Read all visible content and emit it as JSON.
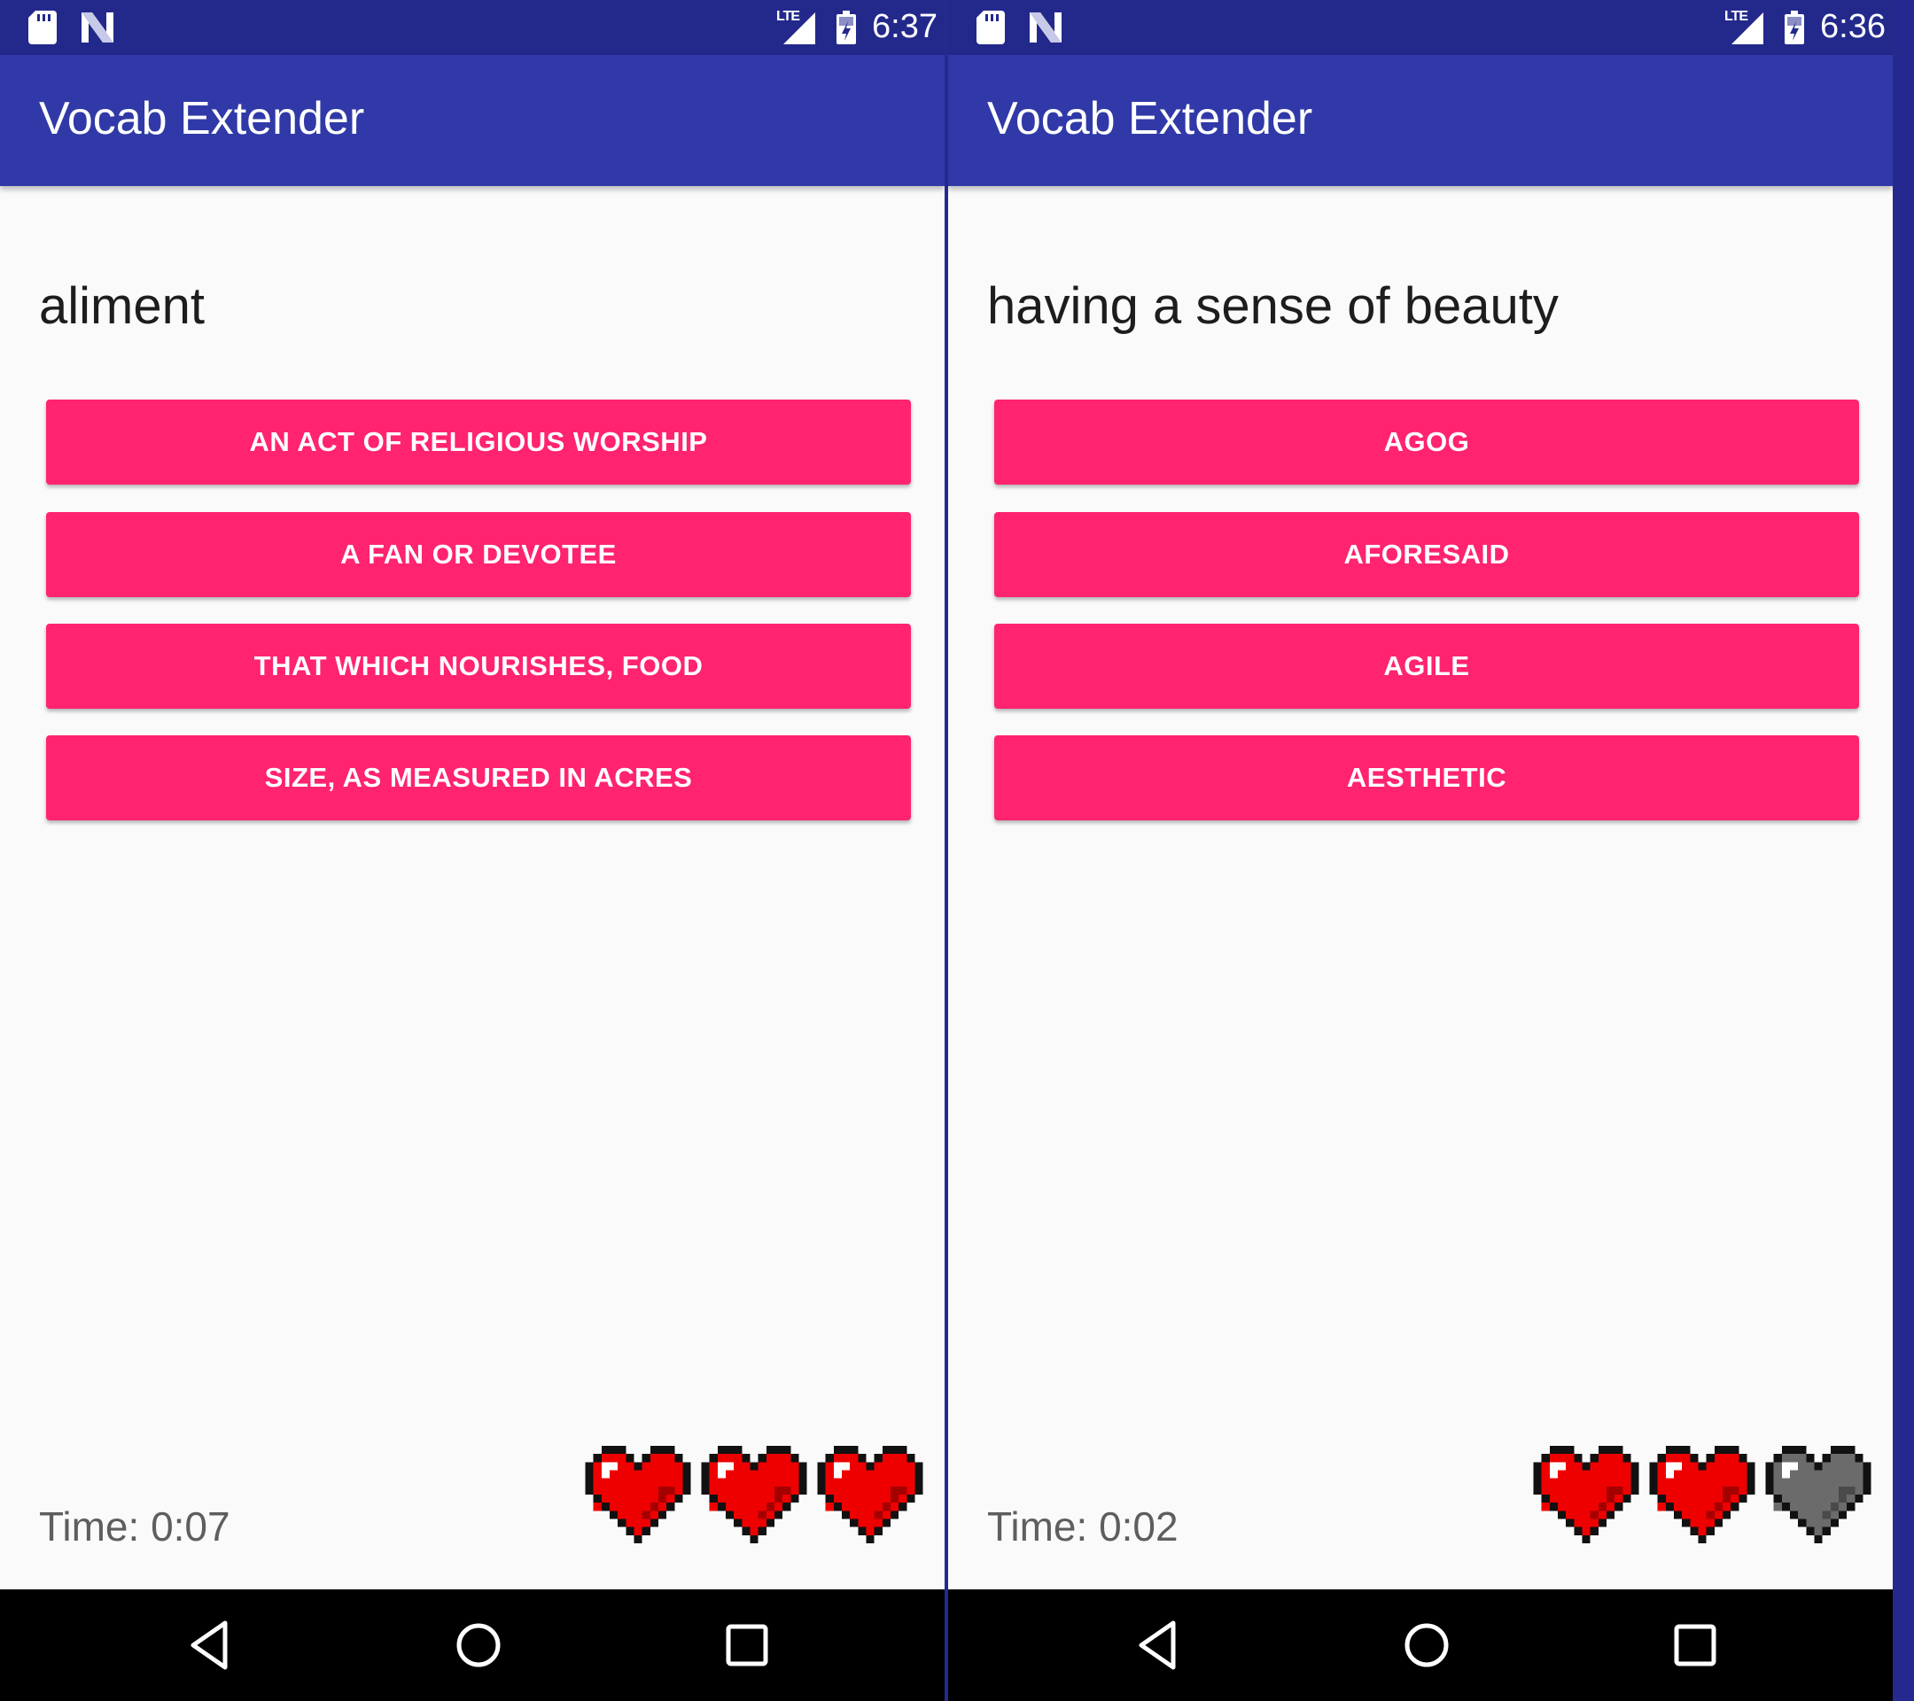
{
  "colors": {
    "status_bar": "#23298b",
    "app_bar": "#3039a7",
    "answer_button": "#ff2370",
    "heart_full": "#ef0000",
    "heart_empty": "#6b6b6b",
    "divider": "#25288f"
  },
  "screens": [
    {
      "status": {
        "time": "6:37",
        "network": "LTE"
      },
      "app_title": "Vocab Extender",
      "question": "aliment",
      "choices": [
        "AN ACT OF RELIGIOUS WORSHIP",
        "A FAN OR DEVOTEE",
        "THAT WHICH NOURISHES, FOOD",
        "SIZE, AS MEASURED IN ACRES"
      ],
      "timer": "Time: 0:07",
      "lives": {
        "remaining": 3,
        "total": 3
      }
    },
    {
      "status": {
        "time": "6:36",
        "network": "LTE"
      },
      "app_title": "Vocab Extender",
      "question": "having a sense of beauty",
      "choices": [
        "AGOG",
        "AFORESAID",
        "AGILE",
        "AESTHETIC"
      ],
      "timer": "Time: 0:02",
      "lives": {
        "remaining": 2,
        "total": 3
      }
    }
  ]
}
